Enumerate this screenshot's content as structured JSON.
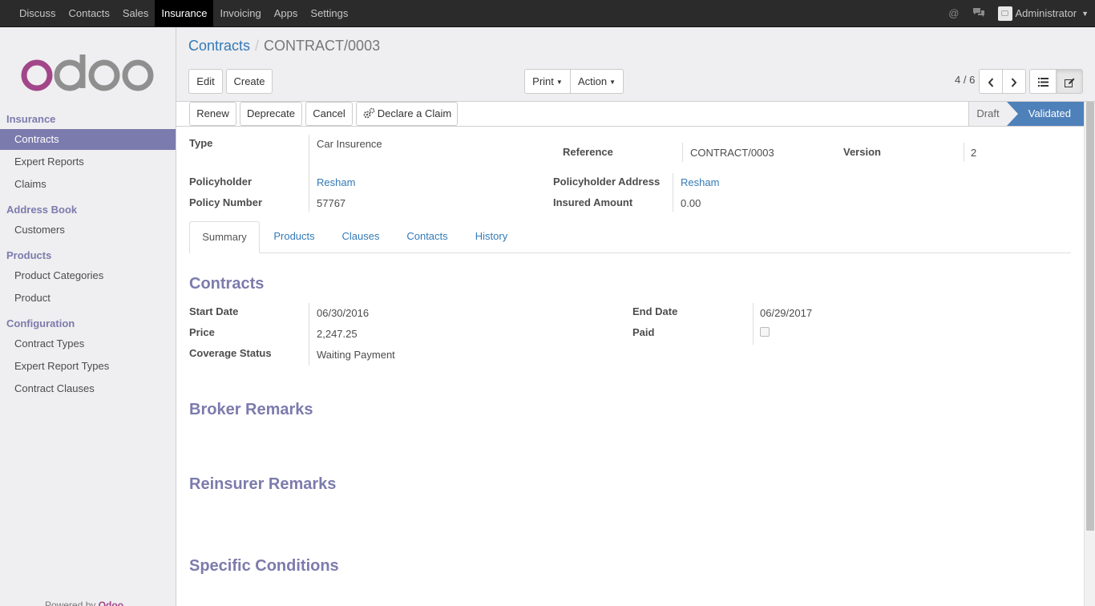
{
  "topbar": {
    "menu": [
      "Discuss",
      "Contacts",
      "Sales",
      "Insurance",
      "Invoicing",
      "Apps",
      "Settings"
    ],
    "active": "Insurance",
    "user": "Administrator"
  },
  "sidebar": {
    "logo": "odoo",
    "sections": [
      {
        "title": "Insurance",
        "items": [
          "Contracts",
          "Expert Reports",
          "Claims"
        ]
      },
      {
        "title": "Address Book",
        "items": [
          "Customers"
        ]
      },
      {
        "title": "Products",
        "items": [
          "Product Categories",
          "Product"
        ]
      },
      {
        "title": "Configuration",
        "items": [
          "Contract Types",
          "Expert Report Types",
          "Contract Clauses"
        ]
      }
    ],
    "active_item": "Contracts",
    "powered_by": "Powered by",
    "powered_brand": "Odoo"
  },
  "control_panel": {
    "breadcrumb_link": "Contracts",
    "breadcrumb_sep": "/",
    "breadcrumb_current": "CONTRACT/0003",
    "edit": "Edit",
    "create": "Create",
    "print": "Print",
    "action": "Action",
    "pager": "4 / 6"
  },
  "statusbar": {
    "buttons": [
      "Renew",
      "Deprecate",
      "Cancel",
      "Declare a Claim"
    ],
    "stages": [
      "Draft",
      "Validated"
    ],
    "active_stage": "Validated"
  },
  "form": {
    "type_label": "Type",
    "type_value": "Car Insurence",
    "reference_label": "Reference",
    "reference_value": "CONTRACT/0003",
    "version_label": "Version",
    "version_value": "2",
    "policyholder_label": "Policyholder",
    "policyholder_value": "Resham",
    "policyholder_address_label": "Policyholder Address",
    "policyholder_address_value": "Resham",
    "policy_number_label": "Policy Number",
    "policy_number_value": "57767",
    "insured_amount_label": "Insured Amount",
    "insured_amount_value": "0.00"
  },
  "tabs": [
    "Summary",
    "Products",
    "Clauses",
    "Contacts",
    "History"
  ],
  "active_tab": "Summary",
  "summary": {
    "contracts_title": "Contracts",
    "start_date_label": "Start Date",
    "start_date_value": "06/30/2016",
    "end_date_label": "End Date",
    "end_date_value": "06/29/2017",
    "price_label": "Price",
    "price_value": "2,247.25",
    "paid_label": "Paid",
    "paid_value": false,
    "coverage_status_label": "Coverage Status",
    "coverage_status_value": "Waiting Payment",
    "broker_remarks_title": "Broker Remarks",
    "reinsurer_remarks_title": "Reinsurer Remarks",
    "specific_conditions_title": "Specific Conditions"
  }
}
